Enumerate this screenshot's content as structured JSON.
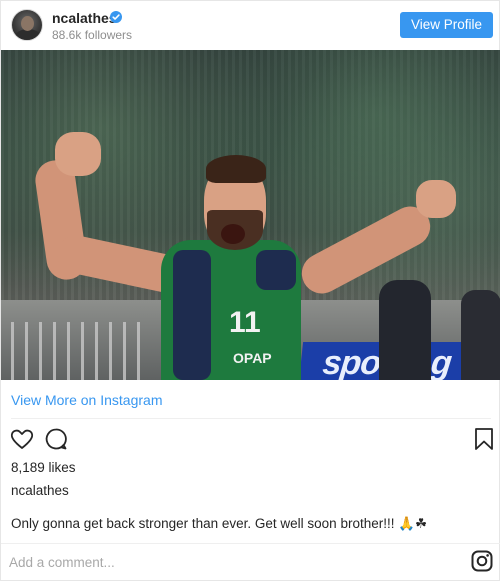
{
  "header": {
    "username": "ncalathes",
    "followers": "88.6k followers",
    "view_profile_label": "View Profile"
  },
  "photo": {
    "jersey_number": "11",
    "jersey_sponsor": "OPAP",
    "banner_text": "sporting"
  },
  "links": {
    "view_more": "View More on Instagram"
  },
  "post": {
    "likes": "8,189 likes",
    "author": "ncalathes",
    "caption": "Only gonna get back stronger than ever. Get well soon brother!!!",
    "caption_emojis": "🙏☘"
  },
  "comment": {
    "placeholder": "Add a comment..."
  },
  "icons": {
    "like": "heart-icon",
    "comment": "comment-bubble-icon",
    "save": "bookmark-icon",
    "brand": "instagram-icon",
    "verified": "verified-badge-icon"
  },
  "colors": {
    "accent": "#3897f0",
    "text": "#262626",
    "muted": "#8e8e8e"
  }
}
